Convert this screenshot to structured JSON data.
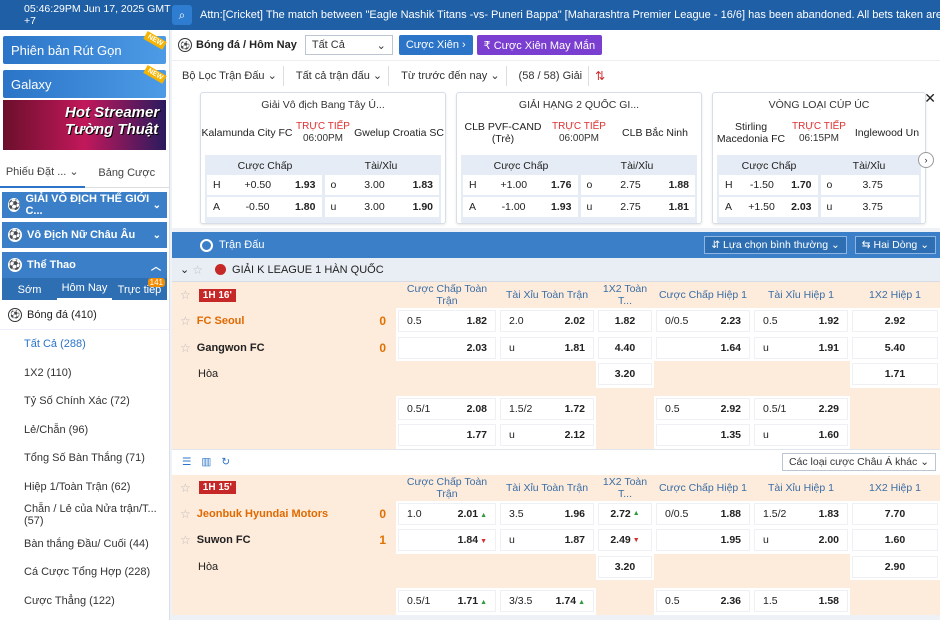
{
  "topbar": {
    "time": "05:46:29PM Jun 17, 2025 GMT +7",
    "ticker": "Attn:[Cricket] The match between \"Eagle Nashik Titans -vs- Puneri Bappa\" [Maharashtra Premier League - 16/6] has been abandoned. All bets taken are REFUNDED (Except th"
  },
  "sidebar": {
    "banner1": "Phiên bản Rút Gọn",
    "banner2": "Galaxy",
    "new_tag": "NEW",
    "promo_line1": "Hot Streamer",
    "promo_line2": "Tường Thuật",
    "slip_tab1": "Phiếu Đặt ...",
    "slip_tab2": "Bảng Cược",
    "sec1": "GIẢI VÔ ĐỊCH THẾ GIỚI C...",
    "sec2": "Vô Địch Nữ Châu Âu",
    "sec3": "Thể Thao",
    "sport_tabs": [
      "Sớm",
      "Hôm Nay",
      "Trực tiếp"
    ],
    "live_count": "141",
    "sport": "Bóng đá",
    "sport_count": "(410)",
    "items": [
      "Tất Cả (288)",
      "1X2 (110)",
      "Tỷ Số Chính Xác (72)",
      "Lẻ/Chẵn (96)",
      "Tổng Số Bàn Thắng (71)",
      "Hiệp 1/Toàn Trận (62)",
      "Chẵn / Lẻ của Nửa trận/T... (57)",
      "Bàn thắng Đầu/ Cuối (44)",
      "Cá Cược Tổng Hợp (228)",
      "Cược Thẳng (122)"
    ]
  },
  "toolbar": {
    "title": "Bóng đá / Hôm Nay",
    "filter_all": "Tất Cả",
    "btn_parlay": "Cược Xiên",
    "btn_lucky": "₹ Cược Xiên May Mắn"
  },
  "filters": {
    "league": "Bộ Lọc Trận Đấu",
    "all_matches": "Tất cả trận đấu",
    "sort": "Từ trước đến nay",
    "count": "(58 / 58) Giải"
  },
  "cards": [
    {
      "league": "Giải Vô địch Bang Tây Ú...",
      "home": "Kalamunda City FC",
      "away": "Gwelup Croatia SC",
      "live": "TRỰC TIẾP",
      "time": "06:00PM",
      "m1": "Cược Chấp",
      "m2": "Tài/Xỉu",
      "r1": [
        "H",
        "+0.50",
        "1.93",
        "o",
        "3.00",
        "1.83"
      ],
      "r2": [
        "A",
        "-0.50",
        "1.80",
        "u",
        "3.00",
        "1.90"
      ]
    },
    {
      "league": "GIẢI HẠNG 2 QUỐC GI...",
      "home": "CLB PVF-CAND (Trẻ)",
      "away": "CLB Bắc Ninh",
      "live": "TRỰC TIẾP",
      "time": "06:00PM",
      "m1": "Cược Chấp",
      "m2": "Tài/Xỉu",
      "r1": [
        "H",
        "+1.00",
        "1.76",
        "o",
        "2.75",
        "1.88"
      ],
      "r2": [
        "A",
        "-1.00",
        "1.93",
        "u",
        "2.75",
        "1.81"
      ]
    },
    {
      "league": "VÒNG LOẠI CÚP ÚC",
      "home": "Stirling Macedonia FC",
      "away": "Inglewood Un",
      "live": "TRỰC TIẾP",
      "time": "06:15PM",
      "m1": "Cược Chấp",
      "m2": "Tài/Xỉu",
      "r1": [
        "H",
        "-1.50",
        "1.70",
        "o",
        "3.75",
        ""
      ],
      "r2": [
        "A",
        "+1.50",
        "2.03",
        "u",
        "3.75",
        ""
      ]
    }
  ],
  "matchbar": {
    "title": "Trận Đấu",
    "sort_sel": "Lựa chọn bình thường",
    "lines_sel": "Hai Dòng"
  },
  "league": "GIẢI K LEAGUE 1 HÀN QUỐC",
  "headers": [
    "Cược Chấp Toàn Trận",
    "Tài Xỉu Toàn Trận",
    "1X2 Toàn T...",
    "Cược Chấp Hiệp 1",
    "Tài Xỉu Hiệp 1",
    "1X2 Hiệp 1"
  ],
  "match1": {
    "tag": "1H 16'",
    "home": "FC Seoul",
    "away": "Gangwon FC",
    "draw": "Hòa",
    "hs": "0",
    "as": "0",
    "r1": [
      "0.5",
      "1.82",
      "2.0",
      "2.02",
      "1.82",
      "0/0.5",
      "2.23",
      "0.5",
      "1.92",
      "2.92"
    ],
    "r2": [
      "",
      "2.03",
      "u",
      "1.81",
      "4.40",
      "",
      "1.64",
      "u",
      "1.91",
      "5.40"
    ],
    "r3": [
      "3.20",
      "1.71"
    ],
    "r4": [
      "0.5/1",
      "2.08",
      "1.5/2",
      "1.72",
      "0.5",
      "2.92",
      "0.5/1",
      "2.29"
    ],
    "r5": [
      "",
      "1.77",
      "u",
      "2.12",
      "",
      "1.35",
      "u",
      "1.60"
    ]
  },
  "tools": {
    "asia": "Các loại cược Châu Á khác"
  },
  "match2": {
    "tag": "1H 15'",
    "home": "Jeonbuk Hyundai Motors",
    "away": "Suwon FC",
    "draw": "Hòa",
    "hs": "0",
    "as": "1",
    "r1": [
      "1.0",
      "2.01",
      "3.5",
      "1.96",
      "2.72",
      "0/0.5",
      "1.88",
      "1.5/2",
      "1.83",
      "7.70"
    ],
    "r2": [
      "",
      "1.84",
      "u",
      "1.87",
      "2.49",
      "",
      "1.95",
      "u",
      "2.00",
      "1.60"
    ],
    "r3": [
      "3.20",
      "2.90"
    ],
    "r4": [
      "0.5/1",
      "1.71",
      "3/3.5",
      "1.74",
      "0.5",
      "2.36",
      "1.5",
      "1.58"
    ]
  }
}
